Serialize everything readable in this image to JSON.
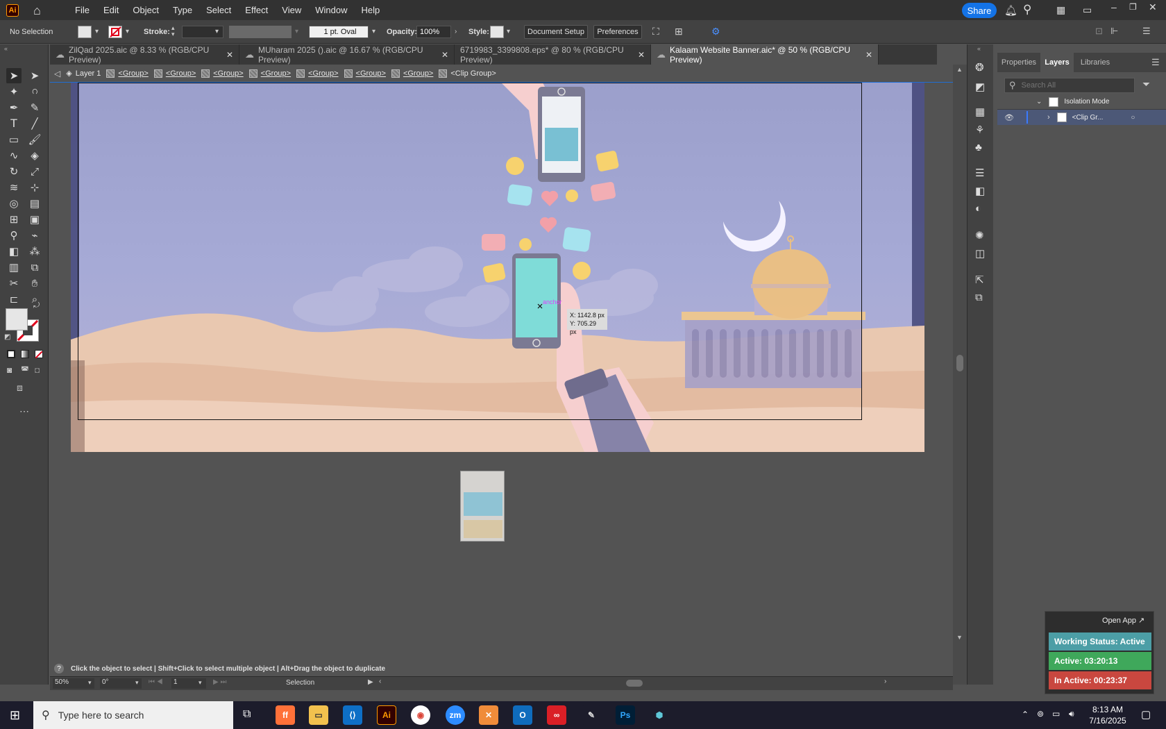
{
  "menubar": {
    "items": [
      "File",
      "Edit",
      "Object",
      "Type",
      "Select",
      "Effect",
      "View",
      "Window",
      "Help"
    ],
    "share_label": "Share"
  },
  "controlbar": {
    "selection": "No Selection",
    "stroke_label": "Stroke:",
    "brush_value": "1 pt. Oval",
    "opacity_label": "Opacity:",
    "opacity_value": "100%",
    "style_label": "Style:",
    "document_setup": "Document Setup",
    "preferences": "Preferences"
  },
  "tabs": [
    {
      "label": "ZilQad 2025.aic @ 8.33 % (RGB/CPU Preview)",
      "active": false
    },
    {
      "label": "MUharam 2025 ().aic @ 16.67 % (RGB/CPU Preview)",
      "active": false
    },
    {
      "label": "6719983_3399808.eps* @ 80 % (RGB/CPU Preview)",
      "active": false
    },
    {
      "label": "Kalaam Website Banner.aic* @ 50 % (RGB/CPU Preview)",
      "active": true
    }
  ],
  "breadcrumb": {
    "layer": "Layer 1",
    "groups": [
      "<Group>",
      "<Group>",
      "<Group>",
      "<Group>",
      "<Group>",
      "<Group>",
      "<Group>"
    ],
    "current": "<Clip Group>"
  },
  "canvas": {
    "anchor_label": "anchor",
    "coord_x": "X: 1142.8 px",
    "coord_y": "Y: 705.29 px"
  },
  "panel": {
    "tabs": [
      "Properties",
      "Layers",
      "Libraries"
    ],
    "search_placeholder": "Search All",
    "isolation_mode": "Isolation Mode",
    "clip_group": "<Clip Gr..."
  },
  "statusbar": {
    "hint": "Click the object to select  |  Shift+Click to select multiple object  |  Alt+Drag the object to duplicate",
    "zoom": "50%",
    "rotation": "0°",
    "artboard": "1",
    "tool": "Selection"
  },
  "widget": {
    "open_app": "Open App ↗",
    "working_status": "Working Status: Active",
    "active": "Active: 03:20:13",
    "inactive": "In Active: 00:23:37"
  },
  "taskbar": {
    "search_placeholder": "Type here to search",
    "time": "8:13 AM",
    "date": "7/16/2025"
  },
  "colors": {
    "share": "#1473e6",
    "status_working": "#4c9ea6",
    "status_active": "#3fa85b",
    "status_inactive": "#c9473f"
  }
}
